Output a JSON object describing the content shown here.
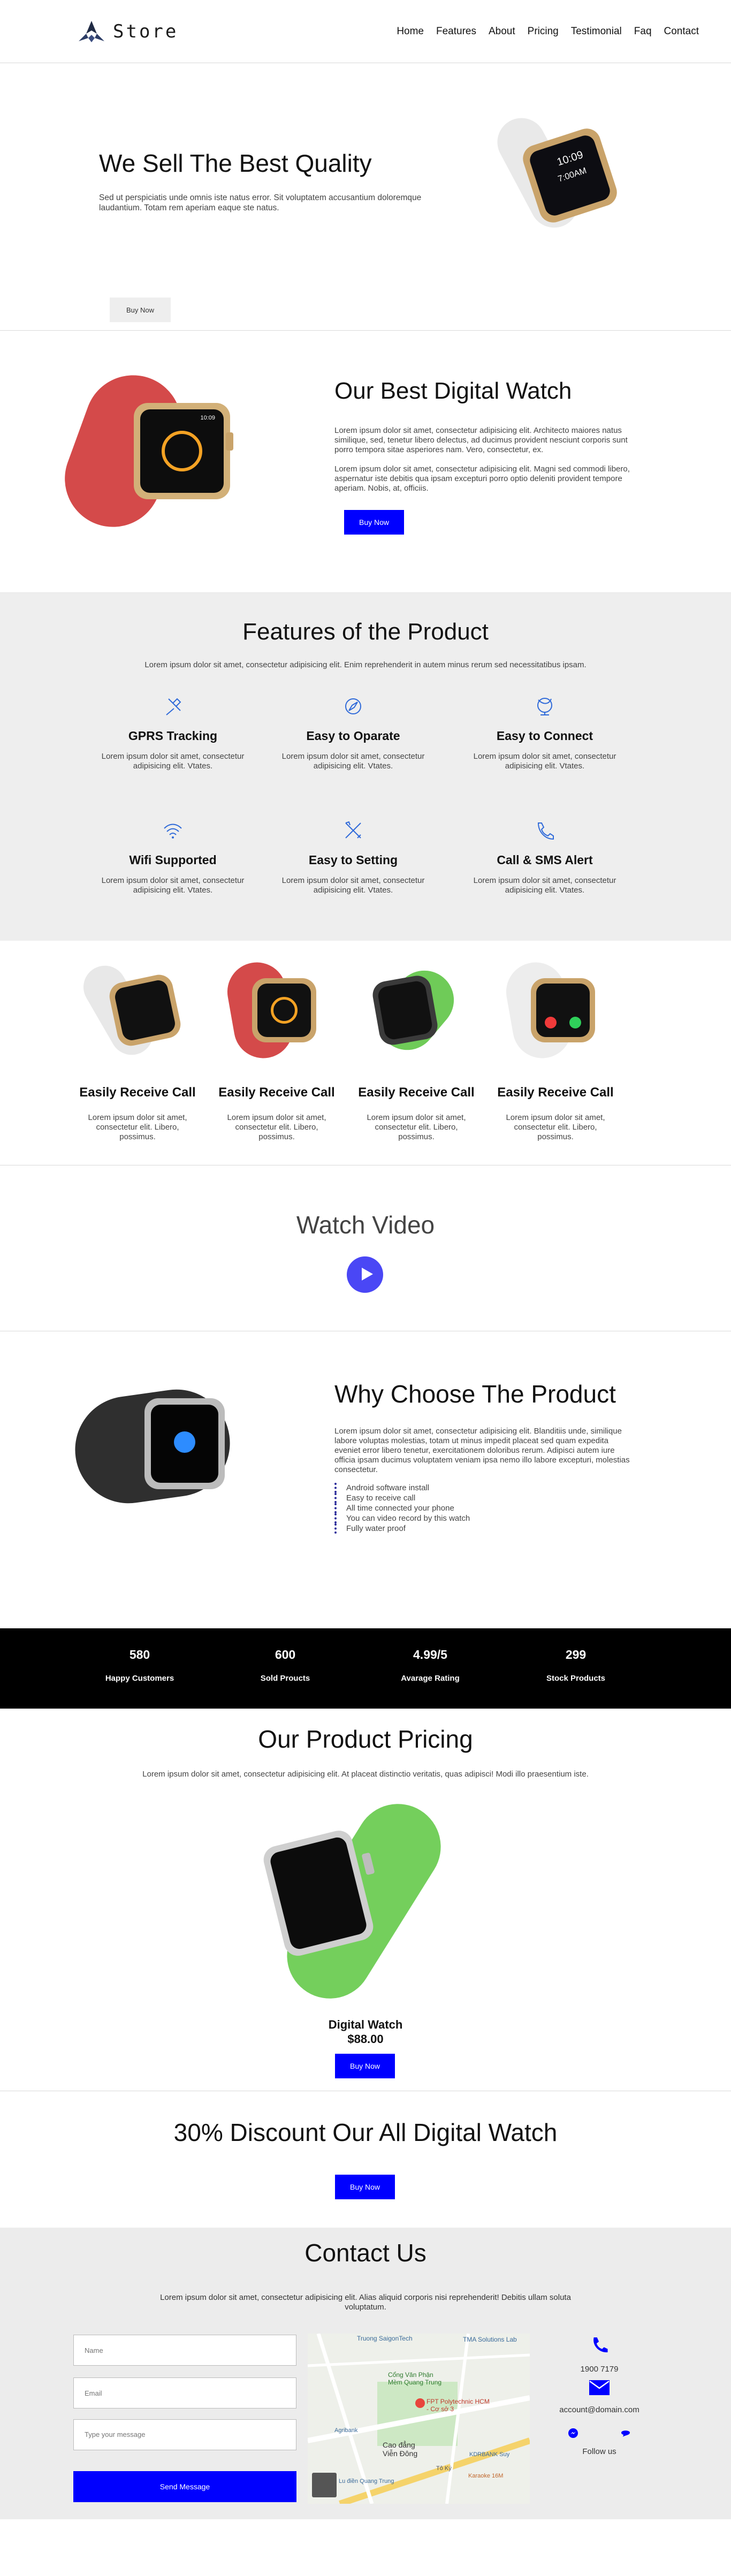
{
  "brand": {
    "name": "Store"
  },
  "nav": [
    "Home",
    "Features",
    "About",
    "Pricing",
    "Testimonial",
    "Faq",
    "Contact"
  ],
  "hero": {
    "title": "We Sell The Best Quality",
    "description": "Sed ut perspiciatis unde omnis iste natus error. Sit voluptatem accusantium doloremque laudantium. Totam rem aperiam eaque ste natus.",
    "button": "Buy Now",
    "watch_screen_time": "10:09",
    "watch_screen_subtime": "7:00AM"
  },
  "best": {
    "title": "Our Best Digital Watch",
    "para1": "Lorem ipsum dolor sit amet, consectetur adipisicing elit. Architecto maiores natus similique, sed, tenetur libero delectus, ad ducimus provident nesciunt corporis sunt porro tempora sitae asperiores nam. Vero, consectetur, ex.",
    "para2": "Lorem ipsum dolor sit amet, consectetur adipisicing elit. Magni sed commodi libero, aspernatur iste debitis qua ipsam excepturi porro optio deleniti provident tempore aperiam. Nobis, at, officiis.",
    "button": "Buy Now",
    "watch_screen_time": "10:09"
  },
  "features": {
    "title": "Features of the Product",
    "subtitle": "Lorem ipsum dolor sit amet, consectetur adipisicing elit. Enim reprehenderit in autem minus rerum sed necessitatibus ipsam.",
    "items": [
      {
        "icon": "pushpin-icon",
        "title": "GPRS Tracking",
        "text": "Lorem ipsum dolor sit amet, consectetur adipisicing elit. Vtates."
      },
      {
        "icon": "compass-icon",
        "title": "Easy to Oparate",
        "text": "Lorem ipsum dolor sit amet, consectetur adipisicing elit. Vtates."
      },
      {
        "icon": "globe-icon",
        "title": "Easy to Connect",
        "text": "Lorem ipsum dolor sit amet, consectetur adipisicing elit. Vtates."
      },
      {
        "icon": "wifi-icon",
        "title": "Wifi Supported",
        "text": "Lorem ipsum dolor sit amet, consectetur adipisicing elit. Vtates."
      },
      {
        "icon": "tools-icon",
        "title": "Easy to Setting",
        "text": "Lorem ipsum dolor sit amet, consectetur adipisicing elit. Vtates."
      },
      {
        "icon": "phone-icon",
        "title": "Call & SMS Alert",
        "text": "Lorem ipsum dolor sit amet, consectetur adipisicing elit. Vtates."
      }
    ]
  },
  "cards": [
    {
      "title": "Easily Receive Call",
      "text": "Lorem ipsum dolor sit amet, consectetur elit. Libero, possimus."
    },
    {
      "title": "Easily Receive Call",
      "text": "Lorem ipsum dolor sit amet, consectetur elit. Libero, possimus."
    },
    {
      "title": "Easily Receive Call",
      "text": "Lorem ipsum dolor sit amet, consectetur elit. Libero, possimus."
    },
    {
      "title": "Easily Receive Call",
      "text": "Lorem ipsum dolor sit amet, consectetur elit. Libero, possimus."
    }
  ],
  "video": {
    "title": "Watch Video"
  },
  "why": {
    "title": "Why Choose The Product",
    "text": "Lorem ipsum dolor sit amet, consectetur adipisicing elit. Blanditiis unde, similique labore voluptas molestias, totam ut minus impedit placeat sed quam expedita eveniet error libero tenetur, exercitationem doloribus rerum. Adipisci autem iure officia ipsam ducimus voluptatem veniam ipsa nemo illo labore excepturi, molestias consectetur.",
    "list": [
      "Android software install",
      "Easy to receive call",
      "All time connected your phone",
      "You can video record by this watch",
      "Fully water proof"
    ]
  },
  "stats": [
    {
      "number": "580",
      "label": "Happy Customers"
    },
    {
      "number": "600",
      "label": "Sold Proucts"
    },
    {
      "number": "4.99/5",
      "label": "Avarage Rating"
    },
    {
      "number": "299",
      "label": "Stock Products"
    }
  ],
  "pricing": {
    "title": "Our Product Pricing",
    "subtitle": "Lorem ipsum dolor sit amet, consectetur adipisicing elit. At placeat distinctio veritatis, quas adipisci! Modi illo praesentium iste.",
    "product_name": "Digital Watch",
    "price": "$88.00",
    "button": "Buy Now"
  },
  "discount": {
    "title": "30% Discount Our All Digital Watch",
    "button": "Buy Now"
  },
  "contact": {
    "title": "Contact Us",
    "subtitle": "Lorem ipsum dolor sit amet, consectetur adipisicing elit. Alias aliquid corporis nisi reprehenderit! Debitis ullam soluta voluptatum.",
    "name_placeholder": "Name",
    "email_placeholder": "Email",
    "message_placeholder": "Type your message",
    "send_button": "Send Message",
    "phone": "1900 7179",
    "email": "account@domain.com",
    "follow": "Follow us",
    "map_labels": [
      "Truong SaigonTech",
      "TMA Solutions Lab",
      "Cổng Văn Phận Mềm Quang Trung",
      "FPT Polytechnic HCM - Cơ sở 3",
      "Cao đẳng Viễn Đông",
      "KDRBANK Suy",
      "Karaoke 16M",
      "Lu điền Quang Trung",
      "Tô Ký",
      "Agribank"
    ]
  }
}
